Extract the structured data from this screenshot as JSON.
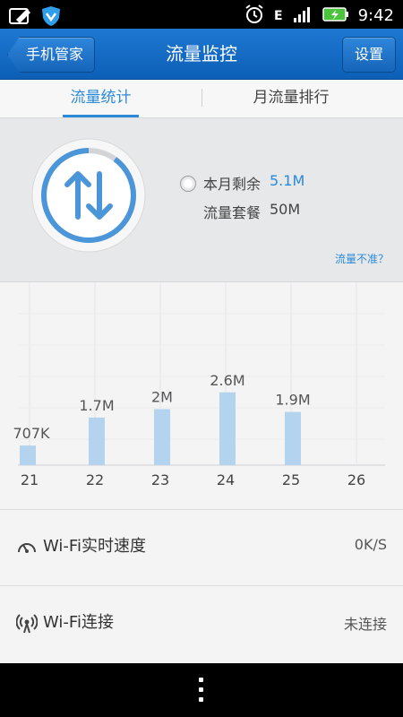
{
  "status_bar": {
    "time": "9:42",
    "network_label": "E",
    "icons": [
      "edit-icon",
      "shield-icon",
      "alarm-icon",
      "signal-icon",
      "battery-charging-icon"
    ]
  },
  "header": {
    "back_label": "手机管家",
    "title": "流量监控",
    "settings_label": "设置"
  },
  "tabs": [
    {
      "label": "流量统计",
      "active": true
    },
    {
      "label": "月流量排行",
      "active": false
    }
  ],
  "summary": {
    "remaining_label": "本月剩余",
    "remaining_value": "5.1M",
    "plan_label": "流量套餐",
    "plan_value": "50M",
    "remaining_fraction": 0.9,
    "inaccurate_link": "流量不准？",
    "accent_color": "#2b8ad8"
  },
  "chart_data": {
    "type": "bar",
    "categories": [
      "21",
      "22",
      "23",
      "24",
      "25",
      "26"
    ],
    "values_mb": [
      0.7,
      1.7,
      2.0,
      2.6,
      1.9,
      0
    ],
    "value_labels": [
      "707K",
      "1.7M",
      "2M",
      "2.6M",
      "1.9M",
      ""
    ],
    "grid": true,
    "bar_color": "#b3d3ee"
  },
  "rows": [
    {
      "icon": "speedometer-icon",
      "label": "Wi-Fi实时速度",
      "value": "0K/S"
    },
    {
      "icon": "wifi-antenna-icon",
      "label": "Wi-Fi连接",
      "value": "未连接"
    }
  ]
}
